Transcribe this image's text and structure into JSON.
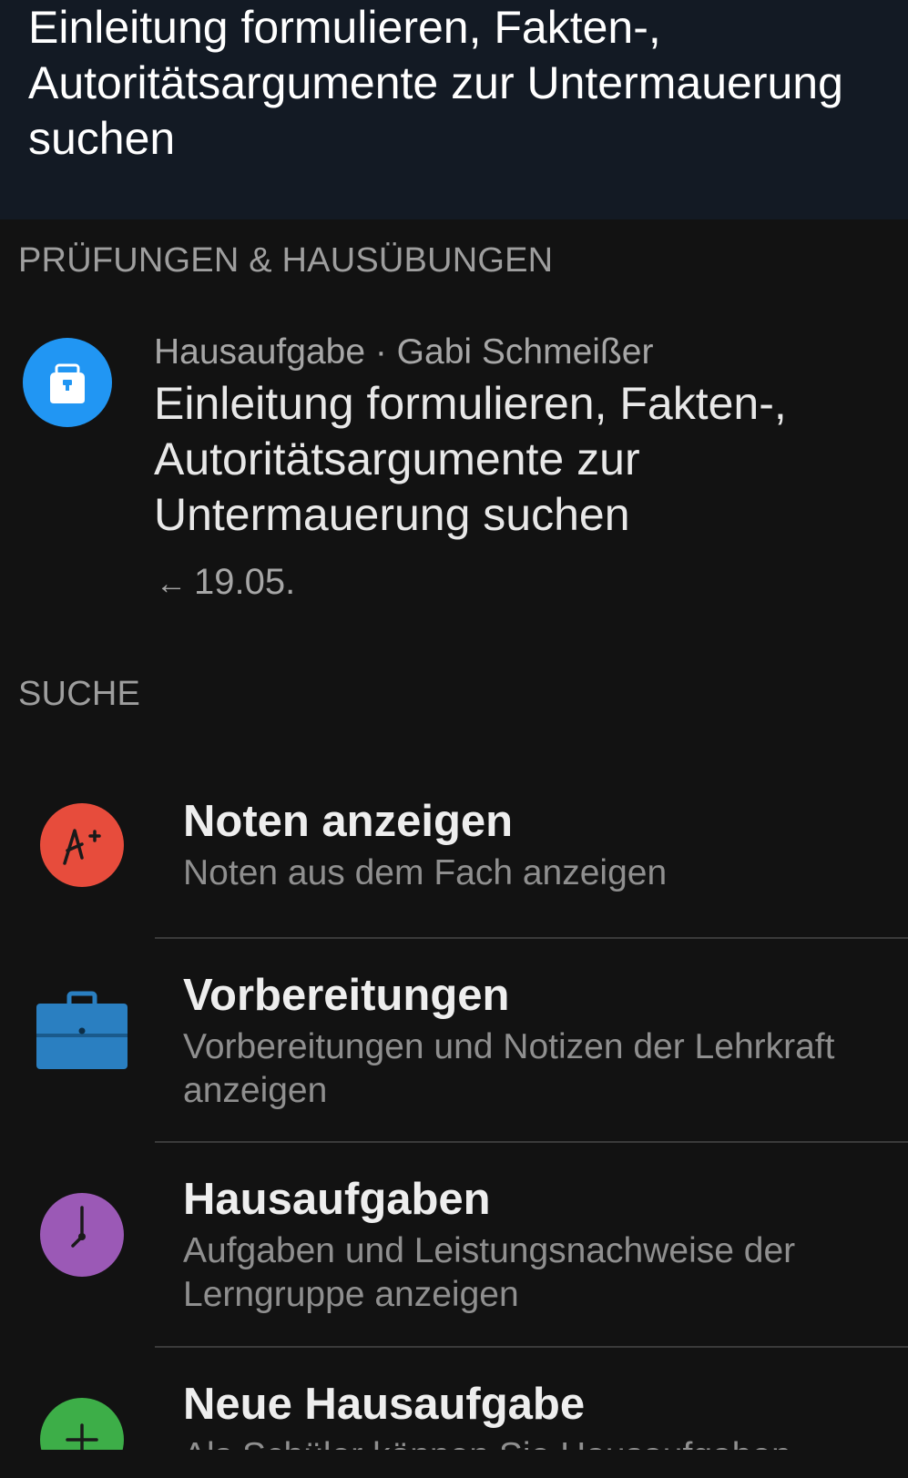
{
  "header": {
    "title": "Einleitung formulieren, Fakten-, Autoritätsargumente zur Untermauerung suchen"
  },
  "sections": {
    "exams_label": "PRÜFUNGEN & HAUSÜBUNGEN",
    "search_label": "SUCHE"
  },
  "homework": {
    "icon": "backpack-icon",
    "icon_color": "#2196f3",
    "meta": "Hausaufgabe · Gabi Schmeißer",
    "title": "Einleitung formulieren, Fakten-, Autoritätsargumente zur Untermauerung suchen",
    "due_arrow": "←",
    "due_date": "19.05."
  },
  "search_items": [
    {
      "icon": "grade-a-plus-icon",
      "icon_color": "#e74c3c",
      "title": "Noten anzeigen",
      "subtitle": "Noten aus dem Fach anzeigen"
    },
    {
      "icon": "briefcase-icon",
      "icon_color": "#2a7fc1",
      "title": "Vorbereitungen",
      "subtitle": "Vorbereitungen und Notizen der Lehrkraft anzeigen"
    },
    {
      "icon": "clock-icon",
      "icon_color": "#9b59b6",
      "title": "Hausaufgaben",
      "subtitle": "Aufgaben und Leistungsnachweise der Lerngruppe anzeigen"
    },
    {
      "icon": "plus-icon",
      "icon_color": "#3dae48",
      "title": "Neue Hausaufgabe",
      "subtitle": "Als Schüler können Sie Hausaufgaben"
    }
  ]
}
